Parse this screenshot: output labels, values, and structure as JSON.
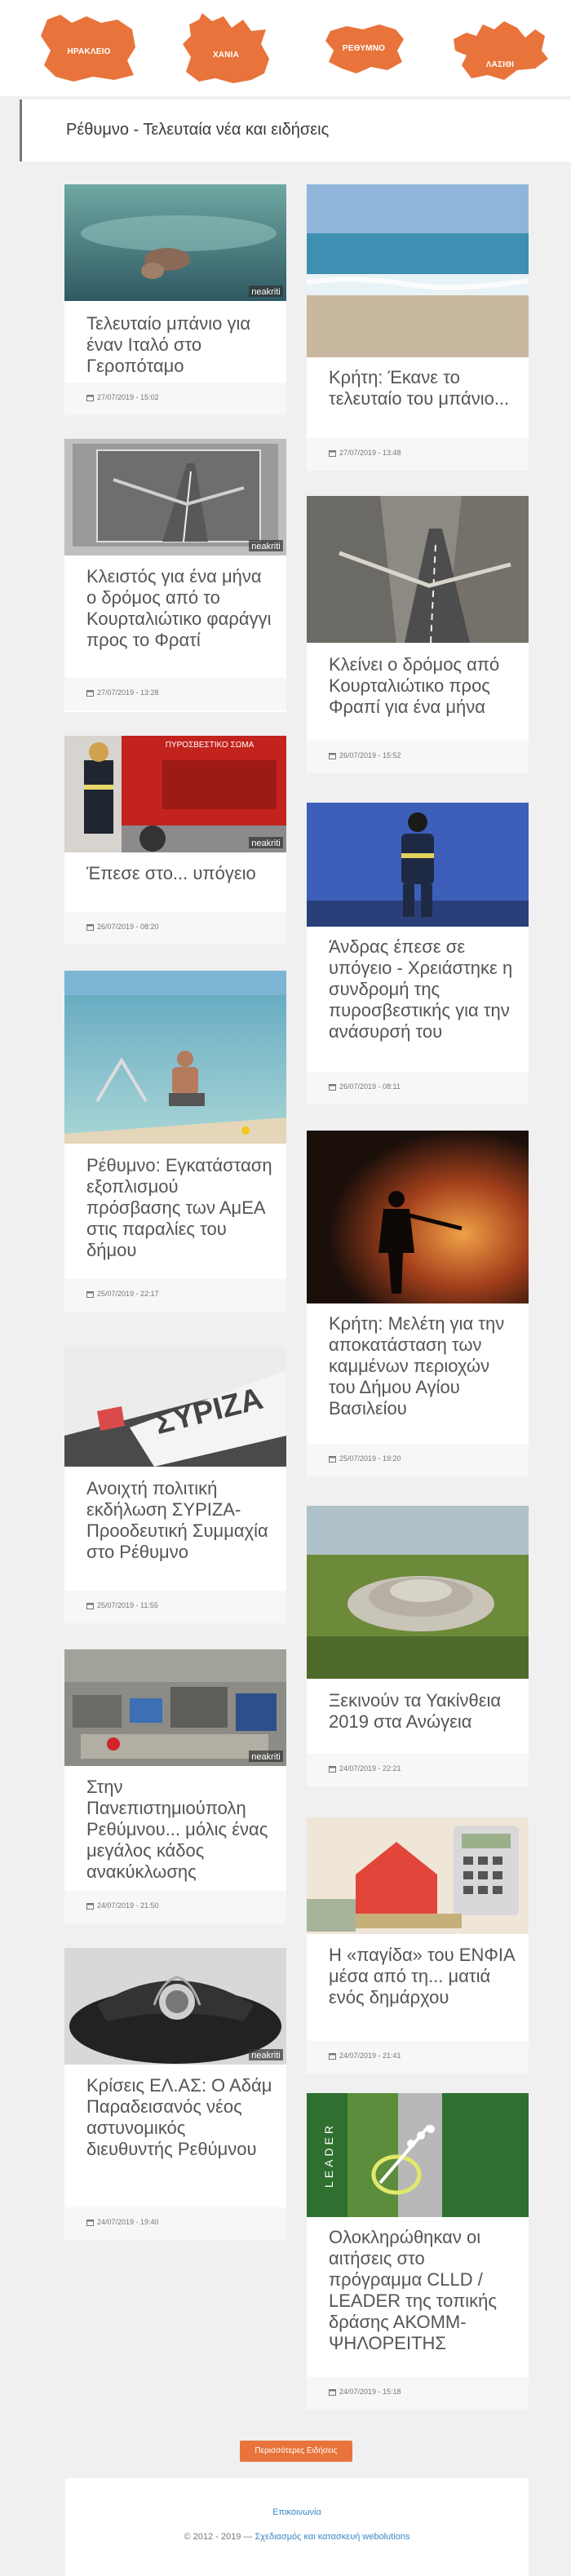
{
  "regions": [
    {
      "name": "ΗΡΑΚΛΕΙΟ"
    },
    {
      "name": "ΧΑΝΙΑ"
    },
    {
      "name": "ΡΕΘΥΜΝΟ"
    },
    {
      "name": "ΛΑΣΙΘΙ"
    }
  ],
  "page_title": "Ρέθυμνο - Τελευταία νέα και ειδήσεις",
  "articles": [
    {
      "title": "Τελευταίο μπάνιο για έναν Ιταλό στο Γεροπόταμο",
      "date": "27/07/2019 - 15:02",
      "watermark": "neakriti"
    },
    {
      "title": "Κρήτη: Έκανε το τελευταίο του μπάνιο...",
      "date": "27/07/2019 - 13:48"
    },
    {
      "title": "Κλειστός για ένα μήνα ο δρόμος από το Κουρταλιώτικο φαράγγι προς το Φρατί",
      "date": "27/07/2019 - 13:28",
      "watermark": "neakriti"
    },
    {
      "title": "Κλείνει ο δρόμος από Κουρταλιώτικο προς Φραπί για ένα μήνα",
      "date": "26/07/2019 - 15:52"
    },
    {
      "title": "Έπεσε στο... υπόγειο",
      "date": "26/07/2019 - 08:20",
      "watermark": "neakriti",
      "sign": "ΠΥΡΟΣΒΕΣΤΙΚΟ ΣΩΜΑ"
    },
    {
      "title": "Άνδρας έπεσε σε υπόγειο - Χρειάστηκε η συνδρομή της πυροσβεστικής για την ανάσυρσή του",
      "date": "26/07/2019 - 08:11"
    },
    {
      "title": "Ρέθυμνο: Εγκατάσταση εξοπλισμού πρόσβασης των ΑμΕΑ στις παραλίες του δήμου",
      "date": "25/07/2019 - 22:17"
    },
    {
      "title": "Κρήτη: Μελέτη για την αποκατάσταση των καμμένων περιοχών του Δήμου Αγίου Βασιλείου",
      "date": "25/07/2019 - 19:20"
    },
    {
      "title": "Ανοιχτή πολιτική εκδήλωση ΣΥΡΙΖΑ-Προοδευτική Συμμαχία στο Ρέθυμνο",
      "date": "25/07/2019 - 11:55",
      "sign": "ΣΥΡΙΖΑ"
    },
    {
      "title": "Ξεκινούν τα Υακίνθεια 2019 στα Ανώγεια",
      "date": "24/07/2019 - 22:21"
    },
    {
      "title": "Στην Πανεπιστημιούπολη Ρεθύμνου... μόλις ένας μεγάλος κάδος ανακύκλωσης",
      "date": "24/07/2019 - 21:50",
      "watermark": "neakriti"
    },
    {
      "title": "Η «παγίδα» του ΕΝΦΙΑ μέσα από τη... ματιά ενός δημάρχου",
      "date": "24/07/2019 - 21:41"
    },
    {
      "title": "Κρίσεις ΕΛ.ΑΣ: Ο Αδάμ Παραδεισανός νέος αστυνομικός διευθυντής Ρεθύμνου",
      "date": "24/07/2019 - 19:40",
      "watermark": "neakriti"
    },
    {
      "title": "Ολοκληρώθηκαν οι αιτήσεις στο πρόγραμμα CLLD / LEADER της τοπικής δράσης ΑΚΟΜΜ-ΨΗΛΟΡΕΙΤΗΣ",
      "date": "24/07/2019 - 15:18",
      "sign": "LEADER"
    }
  ],
  "more_button": "Περισσότερες Ειδήσεις",
  "footer": {
    "contact": "Επικοινωνία",
    "copyright": "© 2012 - 2019 —",
    "credit": "Σχεδιασμός και κατασκευή webolutions"
  },
  "colors": {
    "accent": "#e8743b",
    "link": "#3a88c8"
  }
}
